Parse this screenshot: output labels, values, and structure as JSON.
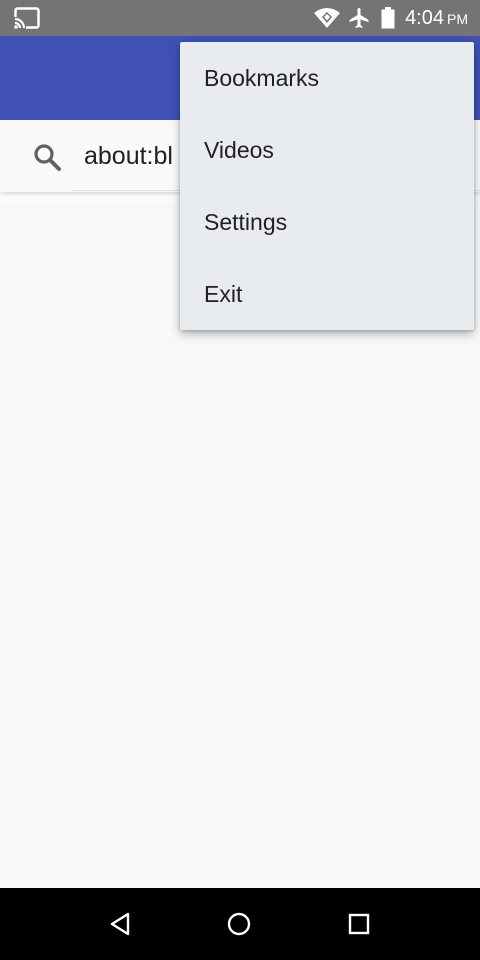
{
  "status_bar": {
    "time": "4:04",
    "ampm": "PM",
    "icons": [
      "cast-icon",
      "wifi-icon",
      "airplane-mode-icon",
      "battery-icon"
    ]
  },
  "colors": {
    "app_bar": "#3f51b5",
    "status_bar": "#747474",
    "menu_bg": "#e9ecef"
  },
  "address_bar": {
    "url": "about:bl",
    "icon": "search-icon"
  },
  "overflow_menu": {
    "items": [
      {
        "label": "Bookmarks"
      },
      {
        "label": "Videos"
      },
      {
        "label": "Settings"
      },
      {
        "label": "Exit"
      }
    ]
  },
  "nav_bar": {
    "icons": [
      "back-icon",
      "home-icon",
      "recents-icon"
    ]
  }
}
